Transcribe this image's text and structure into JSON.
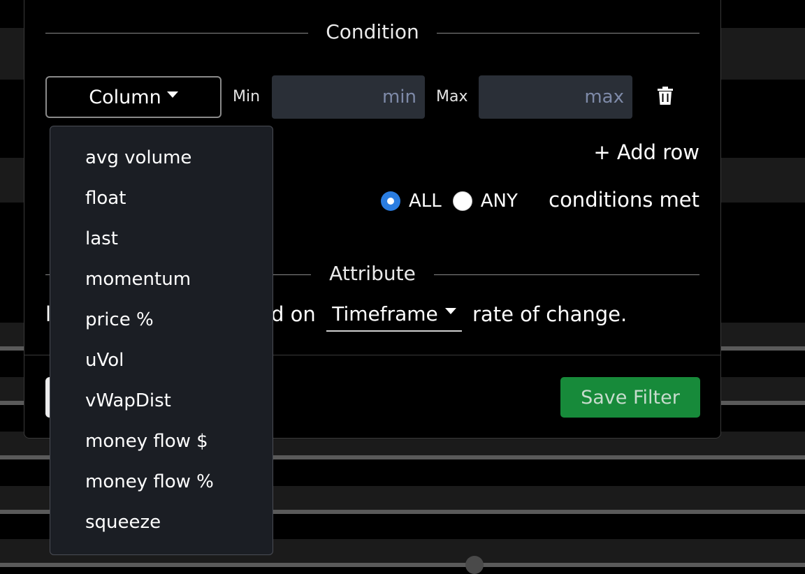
{
  "modal": {
    "condition_title": "Condition",
    "attribute_title": "Attribute",
    "column_button_label": "Column",
    "min_label": "Min",
    "max_label": "Max",
    "min_placeholder": "min",
    "max_placeholder": "max",
    "add_row_label": "+ Add row",
    "radio_all_label": "ALL",
    "radio_any_label": "ANY",
    "selected_radio": "ALL",
    "conditions_met_label": "conditions met",
    "attribute_prefix_visible_start": "l",
    "attribute_prefix_visible_end": "d on",
    "timeframe_label": "Timeframe",
    "rate_of_change_label": "rate of change.",
    "save_filter_label": "Save Filter"
  },
  "dropdown": {
    "items": [
      "avg volume",
      "float",
      "last",
      "momentum",
      "price %",
      "uVol",
      "vWapDist",
      "money flow $",
      "money flow %",
      "squeeze"
    ]
  },
  "colors": {
    "accent_blue": "#2a7de1",
    "save_green": "#178a3a",
    "input_bg": "#2a2f37",
    "dropdown_bg": "#1b1e24"
  },
  "icons": {
    "trash": "trash-icon",
    "caret": "caret-down-icon"
  }
}
